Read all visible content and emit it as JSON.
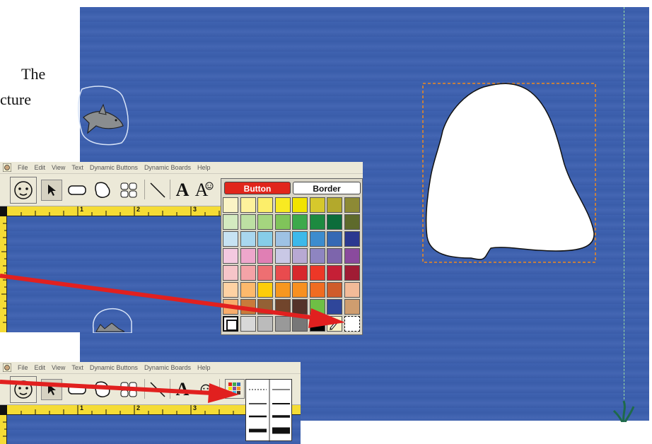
{
  "background_text": {
    "line1": "The",
    "line2": "cture"
  },
  "menu": [
    "File",
    "Edit",
    "View",
    "Text",
    "Dynamic Buttons",
    "Dynamic Boards",
    "Help"
  ],
  "toolbar": {
    "text_tool_label": "A"
  },
  "ruler": {
    "numbers": [
      "1",
      "2",
      "3"
    ],
    "edge_top": "5",
    "edge_bottom": "5"
  },
  "palette": {
    "button_tab": "Button",
    "border_tab": "Border",
    "rows": [
      [
        "#fbf3c5",
        "#fdf29c",
        "#fcee6a",
        "#f8ea22",
        "#f1e300",
        "#d6c82c",
        "#b3a92c",
        "#8d8a35"
      ],
      [
        "#d4eac0",
        "#bde0a3",
        "#a5d57f",
        "#80c45a",
        "#3da94b",
        "#1d8a40",
        "#0c6c3a",
        "#5e6a2c"
      ],
      [
        "#c7e3f3",
        "#a9d7ef",
        "#87cde8",
        "#9ec2e4",
        "#3db9ea",
        "#3d8cce",
        "#3569b4",
        "#2b3890"
      ],
      [
        "#f4c9e0",
        "#eea7cc",
        "#e07fb4",
        "#c9c8e5",
        "#b8a9d3",
        "#8e85c1",
        "#7d65ac",
        "#8a4a9d"
      ],
      [
        "#f6c5c9",
        "#f4a3a7",
        "#ee6f72",
        "#e94b4e",
        "#d7282d",
        "#ed3727",
        "#c51f36",
        "#a01c34"
      ],
      [
        "#fed2a3",
        "#fdb96c",
        "#fecd0a",
        "#f7971e",
        "#f79020",
        "#f06c21",
        "#cf5c2b",
        "#f3bb98"
      ],
      [
        "#f8ad6b",
        "#c97a3a",
        "#946135",
        "#71452c",
        "#54322a",
        "#6ebf45",
        "#2f469a",
        "#cf9d6f"
      ],
      [
        "frame",
        "#d8d8d8",
        "#bbbbbb",
        "#999999",
        "#777777",
        "#000000",
        "pencil",
        "none"
      ]
    ]
  },
  "highlight_colors": {
    "arrow": "#e1201f",
    "selection": "#f08a1c",
    "button_tab_bg": "#e1251b",
    "guide": "#8fd08a"
  },
  "line_styles": {
    "count": 8
  }
}
